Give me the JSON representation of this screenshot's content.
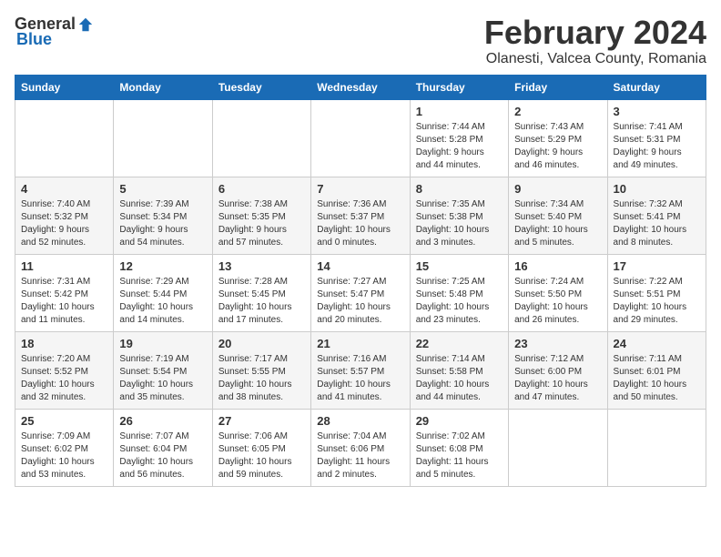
{
  "header": {
    "logo_general": "General",
    "logo_blue": "Blue",
    "main_title": "February 2024",
    "subtitle": "Olanesti, Valcea County, Romania"
  },
  "calendar": {
    "days_of_week": [
      "Sunday",
      "Monday",
      "Tuesday",
      "Wednesday",
      "Thursday",
      "Friday",
      "Saturday"
    ],
    "weeks": [
      [
        {
          "day": "",
          "info": ""
        },
        {
          "day": "",
          "info": ""
        },
        {
          "day": "",
          "info": ""
        },
        {
          "day": "",
          "info": ""
        },
        {
          "day": "1",
          "info": "Sunrise: 7:44 AM\nSunset: 5:28 PM\nDaylight: 9 hours\nand 44 minutes."
        },
        {
          "day": "2",
          "info": "Sunrise: 7:43 AM\nSunset: 5:29 PM\nDaylight: 9 hours\nand 46 minutes."
        },
        {
          "day": "3",
          "info": "Sunrise: 7:41 AM\nSunset: 5:31 PM\nDaylight: 9 hours\nand 49 minutes."
        }
      ],
      [
        {
          "day": "4",
          "info": "Sunrise: 7:40 AM\nSunset: 5:32 PM\nDaylight: 9 hours\nand 52 minutes."
        },
        {
          "day": "5",
          "info": "Sunrise: 7:39 AM\nSunset: 5:34 PM\nDaylight: 9 hours\nand 54 minutes."
        },
        {
          "day": "6",
          "info": "Sunrise: 7:38 AM\nSunset: 5:35 PM\nDaylight: 9 hours\nand 57 minutes."
        },
        {
          "day": "7",
          "info": "Sunrise: 7:36 AM\nSunset: 5:37 PM\nDaylight: 10 hours\nand 0 minutes."
        },
        {
          "day": "8",
          "info": "Sunrise: 7:35 AM\nSunset: 5:38 PM\nDaylight: 10 hours\nand 3 minutes."
        },
        {
          "day": "9",
          "info": "Sunrise: 7:34 AM\nSunset: 5:40 PM\nDaylight: 10 hours\nand 5 minutes."
        },
        {
          "day": "10",
          "info": "Sunrise: 7:32 AM\nSunset: 5:41 PM\nDaylight: 10 hours\nand 8 minutes."
        }
      ],
      [
        {
          "day": "11",
          "info": "Sunrise: 7:31 AM\nSunset: 5:42 PM\nDaylight: 10 hours\nand 11 minutes."
        },
        {
          "day": "12",
          "info": "Sunrise: 7:29 AM\nSunset: 5:44 PM\nDaylight: 10 hours\nand 14 minutes."
        },
        {
          "day": "13",
          "info": "Sunrise: 7:28 AM\nSunset: 5:45 PM\nDaylight: 10 hours\nand 17 minutes."
        },
        {
          "day": "14",
          "info": "Sunrise: 7:27 AM\nSunset: 5:47 PM\nDaylight: 10 hours\nand 20 minutes."
        },
        {
          "day": "15",
          "info": "Sunrise: 7:25 AM\nSunset: 5:48 PM\nDaylight: 10 hours\nand 23 minutes."
        },
        {
          "day": "16",
          "info": "Sunrise: 7:24 AM\nSunset: 5:50 PM\nDaylight: 10 hours\nand 26 minutes."
        },
        {
          "day": "17",
          "info": "Sunrise: 7:22 AM\nSunset: 5:51 PM\nDaylight: 10 hours\nand 29 minutes."
        }
      ],
      [
        {
          "day": "18",
          "info": "Sunrise: 7:20 AM\nSunset: 5:52 PM\nDaylight: 10 hours\nand 32 minutes."
        },
        {
          "day": "19",
          "info": "Sunrise: 7:19 AM\nSunset: 5:54 PM\nDaylight: 10 hours\nand 35 minutes."
        },
        {
          "day": "20",
          "info": "Sunrise: 7:17 AM\nSunset: 5:55 PM\nDaylight: 10 hours\nand 38 minutes."
        },
        {
          "day": "21",
          "info": "Sunrise: 7:16 AM\nSunset: 5:57 PM\nDaylight: 10 hours\nand 41 minutes."
        },
        {
          "day": "22",
          "info": "Sunrise: 7:14 AM\nSunset: 5:58 PM\nDaylight: 10 hours\nand 44 minutes."
        },
        {
          "day": "23",
          "info": "Sunrise: 7:12 AM\nSunset: 6:00 PM\nDaylight: 10 hours\nand 47 minutes."
        },
        {
          "day": "24",
          "info": "Sunrise: 7:11 AM\nSunset: 6:01 PM\nDaylight: 10 hours\nand 50 minutes."
        }
      ],
      [
        {
          "day": "25",
          "info": "Sunrise: 7:09 AM\nSunset: 6:02 PM\nDaylight: 10 hours\nand 53 minutes."
        },
        {
          "day": "26",
          "info": "Sunrise: 7:07 AM\nSunset: 6:04 PM\nDaylight: 10 hours\nand 56 minutes."
        },
        {
          "day": "27",
          "info": "Sunrise: 7:06 AM\nSunset: 6:05 PM\nDaylight: 10 hours\nand 59 minutes."
        },
        {
          "day": "28",
          "info": "Sunrise: 7:04 AM\nSunset: 6:06 PM\nDaylight: 11 hours\nand 2 minutes."
        },
        {
          "day": "29",
          "info": "Sunrise: 7:02 AM\nSunset: 6:08 PM\nDaylight: 11 hours\nand 5 minutes."
        },
        {
          "day": "",
          "info": ""
        },
        {
          "day": "",
          "info": ""
        }
      ]
    ]
  }
}
